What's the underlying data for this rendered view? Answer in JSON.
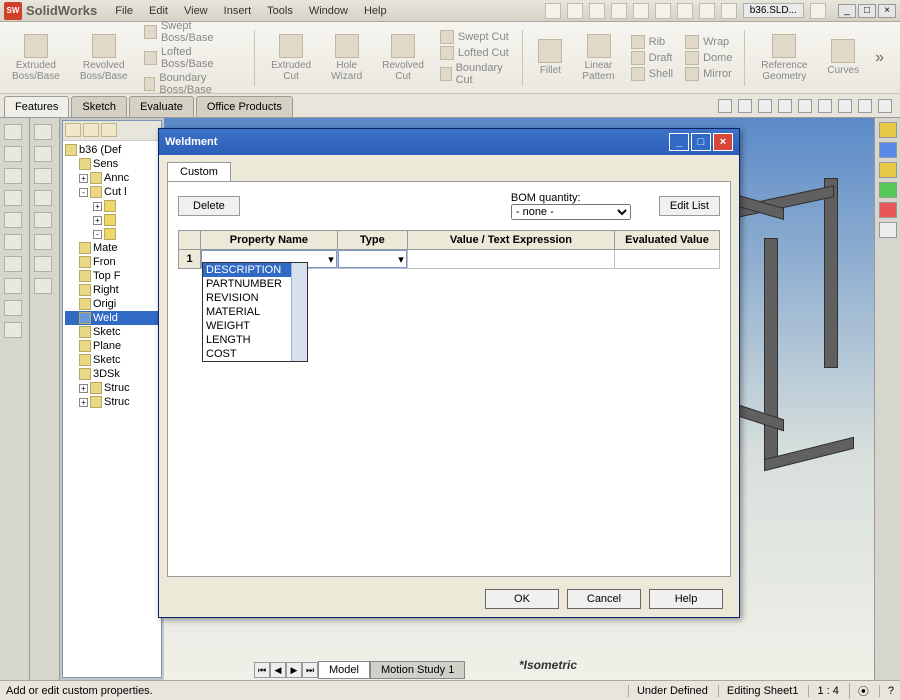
{
  "app": {
    "brand": "SolidWorks",
    "doc_tab": "b36.SLD..."
  },
  "menu": [
    "File",
    "Edit",
    "View",
    "Insert",
    "Tools",
    "Window",
    "Help"
  ],
  "ribbon": {
    "big": [
      {
        "label": "Extruded\nBoss/Base"
      },
      {
        "label": "Revolved\nBoss/Base"
      }
    ],
    "col1": [
      "Swept Boss/Base",
      "Lofted Boss/Base",
      "Boundary Boss/Base"
    ],
    "big2": [
      {
        "label": "Extruded\nCut"
      },
      {
        "label": "Hole\nWizard"
      },
      {
        "label": "Revolved\nCut"
      }
    ],
    "col2": [
      "Swept Cut",
      "Lofted Cut",
      "Boundary Cut"
    ],
    "big3": [
      {
        "label": "Fillet"
      },
      {
        "label": "Linear\nPattern"
      }
    ],
    "col3": [
      "Rib",
      "Draft",
      "Shell"
    ],
    "col4": [
      "Wrap",
      "Dome",
      "Mirror"
    ],
    "big4": [
      {
        "label": "Reference\nGeometry"
      },
      {
        "label": "Curves"
      }
    ]
  },
  "tabs": [
    "Features",
    "Sketch",
    "Evaluate",
    "Office Products"
  ],
  "tree": {
    "root": "b36 (Def",
    "items": [
      "Sens",
      "Annc",
      "Cut l",
      "Mate",
      "Fron",
      "Top F",
      "Right",
      "Origi",
      "Weld",
      "Sketc",
      "Plane",
      "Sketc",
      "3DSk",
      "Struc",
      "Struc"
    ],
    "selected_index": 8
  },
  "canvas": {
    "iso_label": "*Isometric"
  },
  "bottom_tabs": {
    "a": "Model",
    "b": "Motion Study 1"
  },
  "statusbar": {
    "hint": "Add or edit custom properties.",
    "state": "Under Defined",
    "sheet": "Editing Sheet1",
    "ratio": "1 : 4"
  },
  "dialog": {
    "title": "Weldment",
    "tab": "Custom",
    "delete_btn": "Delete",
    "bom_label": "BOM quantity:",
    "bom_value": "- none -",
    "edit_list_btn": "Edit List",
    "columns": [
      "Property Name",
      "Type",
      "Value / Text Expression",
      "Evaluated Value"
    ],
    "row1": "1",
    "dropdown_opts": [
      "DESCRIPTION",
      "PARTNUMBER",
      "REVISION",
      "MATERIAL",
      "WEIGHT",
      "LENGTH",
      "COST"
    ],
    "dropdown_hl_index": 0,
    "buttons": {
      "ok": "OK",
      "cancel": "Cancel",
      "help": "Help"
    }
  }
}
